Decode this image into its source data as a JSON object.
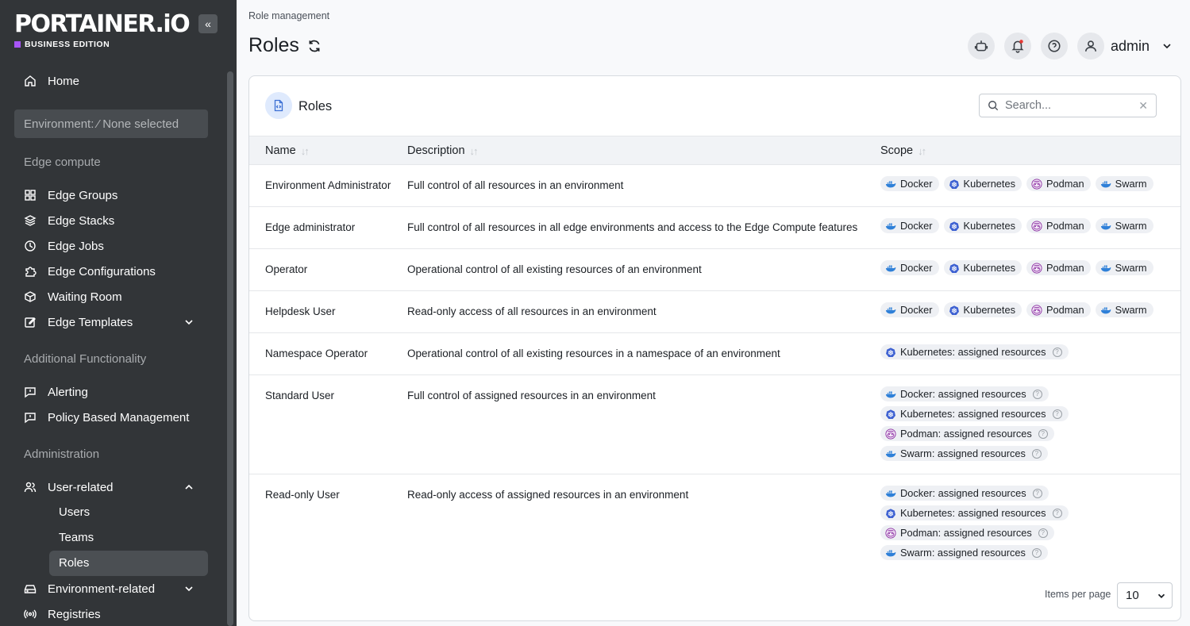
{
  "sidebar": {
    "logo": "PORTAINER.iO",
    "edition": "BUSINESS EDITION",
    "collapse_glyph": "«",
    "home": "Home",
    "environment": "Environment: ⁄ None selected",
    "sections": {
      "edge": "Edge compute",
      "additional": "Additional Functionality",
      "admin": "Administration"
    },
    "edge_items": [
      "Edge Groups",
      "Edge Stacks",
      "Edge Jobs",
      "Edge Configurations",
      "Waiting Room",
      "Edge Templates"
    ],
    "additional_items": [
      "Alerting",
      "Policy Based Management"
    ],
    "admin_items": {
      "user_related": "User-related",
      "users": "Users",
      "teams": "Teams",
      "roles": "Roles",
      "environment_related": "Environment-related",
      "registries": "Registries"
    }
  },
  "header": {
    "breadcrumb": "Role management",
    "title": "Roles",
    "user": "admin"
  },
  "card": {
    "title": "Roles",
    "search_placeholder": "Search...",
    "clear": "✕",
    "columns": [
      "Name",
      "Description",
      "Scope"
    ],
    "rows": [
      {
        "name": "Environment Administrator",
        "description": "Full control of all resources in an environment",
        "scope": [
          "Docker",
          "Kubernetes",
          "Podman",
          "Swarm"
        ]
      },
      {
        "name": "Edge administrator",
        "description": "Full control of all resources in all edge environments and access to the Edge Compute features",
        "scope": [
          "Docker",
          "Kubernetes",
          "Podman",
          "Swarm"
        ]
      },
      {
        "name": "Operator",
        "description": "Operational control of all existing resources of an environment",
        "scope": [
          "Docker",
          "Kubernetes",
          "Podman",
          "Swarm"
        ]
      },
      {
        "name": "Helpdesk User",
        "description": "Read-only access of all resources in an environment",
        "scope": [
          "Docker",
          "Kubernetes",
          "Podman",
          "Swarm"
        ]
      },
      {
        "name": "Namespace Operator",
        "description": "Operational control of all existing resources in a namespace of an environment",
        "scope": [
          "Kubernetes: assigned resources"
        ]
      },
      {
        "name": "Standard User",
        "description": "Full control of assigned resources in an environment",
        "scope": [
          "Docker: assigned resources",
          "Kubernetes: assigned resources",
          "Podman: assigned resources",
          "Swarm: assigned resources"
        ]
      },
      {
        "name": "Read-only User",
        "description": "Read-only access of assigned resources in an environment",
        "scope": [
          "Docker: assigned resources",
          "Kubernetes: assigned resources",
          "Podman: assigned resources",
          "Swarm: assigned resources"
        ]
      }
    ],
    "items_per_page_label": "Items per page",
    "items_per_page": "10"
  },
  "colors": {
    "sidebar_bg": "#323538",
    "accent": "#a855f7",
    "docker": "#2f80d8",
    "kubernetes": "#3b5fd1",
    "podman": "#892ca0"
  }
}
